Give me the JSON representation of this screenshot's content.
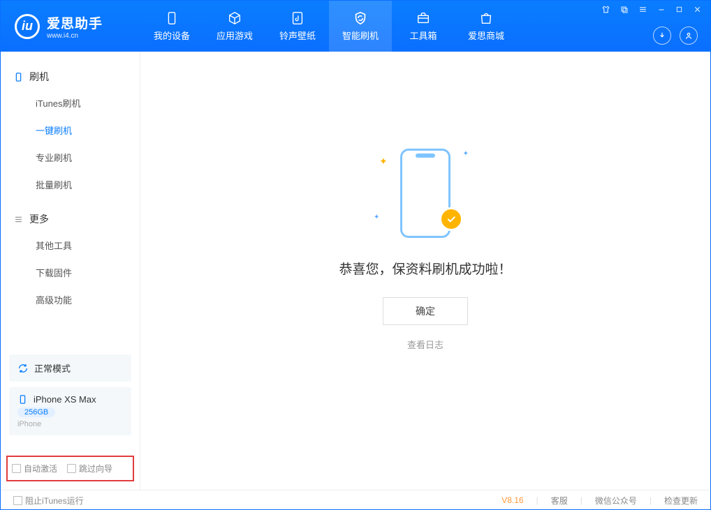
{
  "app": {
    "title": "爱思助手",
    "url": "www.i4.cn"
  },
  "nav": {
    "tabs": [
      {
        "label": "我的设备"
      },
      {
        "label": "应用游戏"
      },
      {
        "label": "铃声壁纸"
      },
      {
        "label": "智能刷机"
      },
      {
        "label": "工具箱"
      },
      {
        "label": "爱思商城"
      }
    ]
  },
  "sidebar": {
    "section1": {
      "title": "刷机",
      "items": [
        "iTunes刷机",
        "一键刷机",
        "专业刷机",
        "批量刷机"
      ]
    },
    "section2": {
      "title": "更多",
      "items": [
        "其他工具",
        "下载固件",
        "高级功能"
      ]
    },
    "mode": "正常模式",
    "device": {
      "name": "iPhone XS Max",
      "storage": "256GB",
      "type": "iPhone"
    },
    "checks": {
      "auto_activate": "自动激活",
      "skip_wizard": "跳过向导"
    }
  },
  "main": {
    "success_msg": "恭喜您，保资料刷机成功啦！",
    "ok_btn": "确定",
    "view_log": "查看日志"
  },
  "footer": {
    "block_itunes": "阻止iTunes运行",
    "version": "V8.16",
    "links": [
      "客服",
      "微信公众号",
      "检查更新"
    ]
  }
}
